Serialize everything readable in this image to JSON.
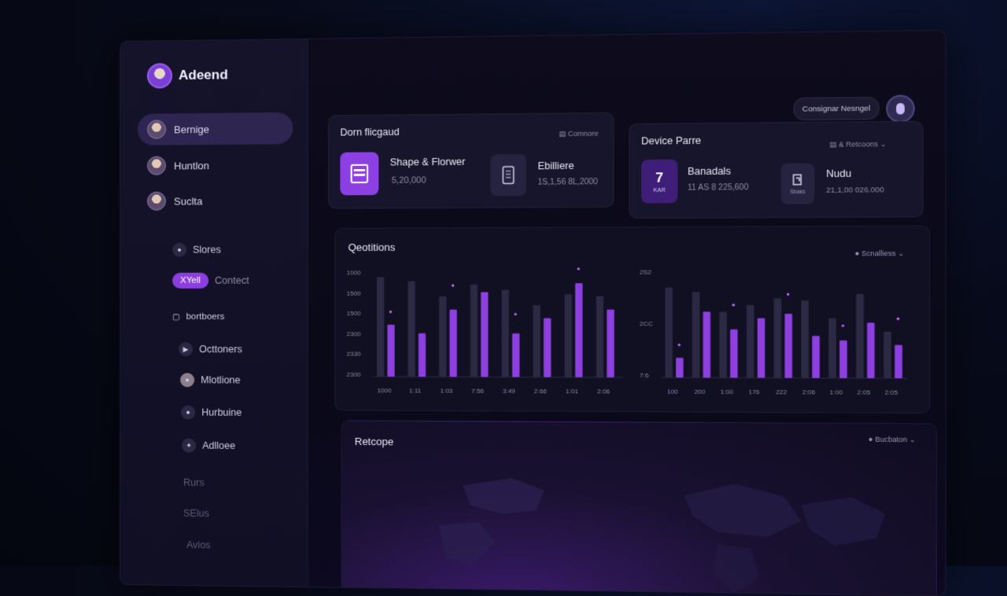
{
  "brand": {
    "name": "Adeend"
  },
  "nav_people": [
    {
      "label": "Bernige",
      "active": true
    },
    {
      "label": "Huntlon",
      "active": false
    },
    {
      "label": "Suclta",
      "active": false
    }
  ],
  "nav_sub": [
    {
      "label": "Slores",
      "icon": "person-icon"
    },
    {
      "pill": "XYell",
      "label": "Contect"
    },
    {
      "label": "bortboers",
      "icon": "folder-icon"
    },
    {
      "label": "Octtoners",
      "icon": "play-icon"
    },
    {
      "label": "Mlotlione",
      "icon": "avatar-icon"
    },
    {
      "label": "Hurbuine",
      "icon": "people-icon"
    },
    {
      "label": "Adlloee",
      "icon": "star-icon"
    }
  ],
  "nav_faded": [
    "Rurs",
    "SElus",
    "Avios"
  ],
  "top": {
    "search_label": "Consignar Nesngel"
  },
  "card1": {
    "title": "Dorn flicgaud",
    "meta": "Comnore",
    "stat1": {
      "label": "Shape & Florwer",
      "value": "5,20,000"
    },
    "stat2": {
      "label": "Ebilliere",
      "value": "1S,1,56 8L,2000"
    }
  },
  "card2": {
    "title": "Device Parre",
    "meta": "& Retcoons",
    "stat1": {
      "num": "7",
      "tag": "KAR",
      "label": "Banadals",
      "value": "11 AS 8 225,600"
    },
    "stat2": {
      "tag": "Sbaks",
      "label": "Nudu",
      "value": "21,1,00 026.000"
    }
  },
  "chart_section": {
    "title": "Qeotitions",
    "filter": "Scnalliess"
  },
  "chart_data": [
    {
      "type": "bar",
      "y_ticks": [
        "1000",
        "1500",
        "1500",
        "2300",
        "2330",
        "2300"
      ],
      "categories": [
        "1000",
        "1:11",
        "1:03",
        "7:56",
        "3:49",
        "2:66",
        "1:01",
        "2:06"
      ],
      "series": [
        {
          "values": [
            92,
            88,
            74,
            85,
            80,
            66,
            76,
            74
          ]
        },
        {
          "values": [
            48,
            40,
            62,
            78,
            40,
            54,
            86,
            62
          ]
        }
      ],
      "colors": {
        "bar_dark": "#2c2944",
        "bar_accent": "#8e3fe0"
      }
    },
    {
      "type": "bar",
      "y_ticks": [
        "2S2",
        "2CC",
        "7:6"
      ],
      "categories": [
        "100",
        "200",
        "1:00",
        "176",
        "222",
        "2:06",
        "1:00",
        "2:05",
        "2:05"
      ],
      "series": [
        {
          "values": [
            82,
            78,
            60,
            66,
            72,
            70,
            54,
            76,
            42
          ]
        },
        {
          "values": [
            18,
            60,
            44,
            54,
            58,
            38,
            34,
            50,
            30
          ]
        }
      ],
      "colors": {
        "bar_dark": "#2c2944",
        "bar_accent": "#8e3fe0"
      }
    }
  ],
  "map_section": {
    "title": "Retcope",
    "filter": "Bucbaton"
  }
}
